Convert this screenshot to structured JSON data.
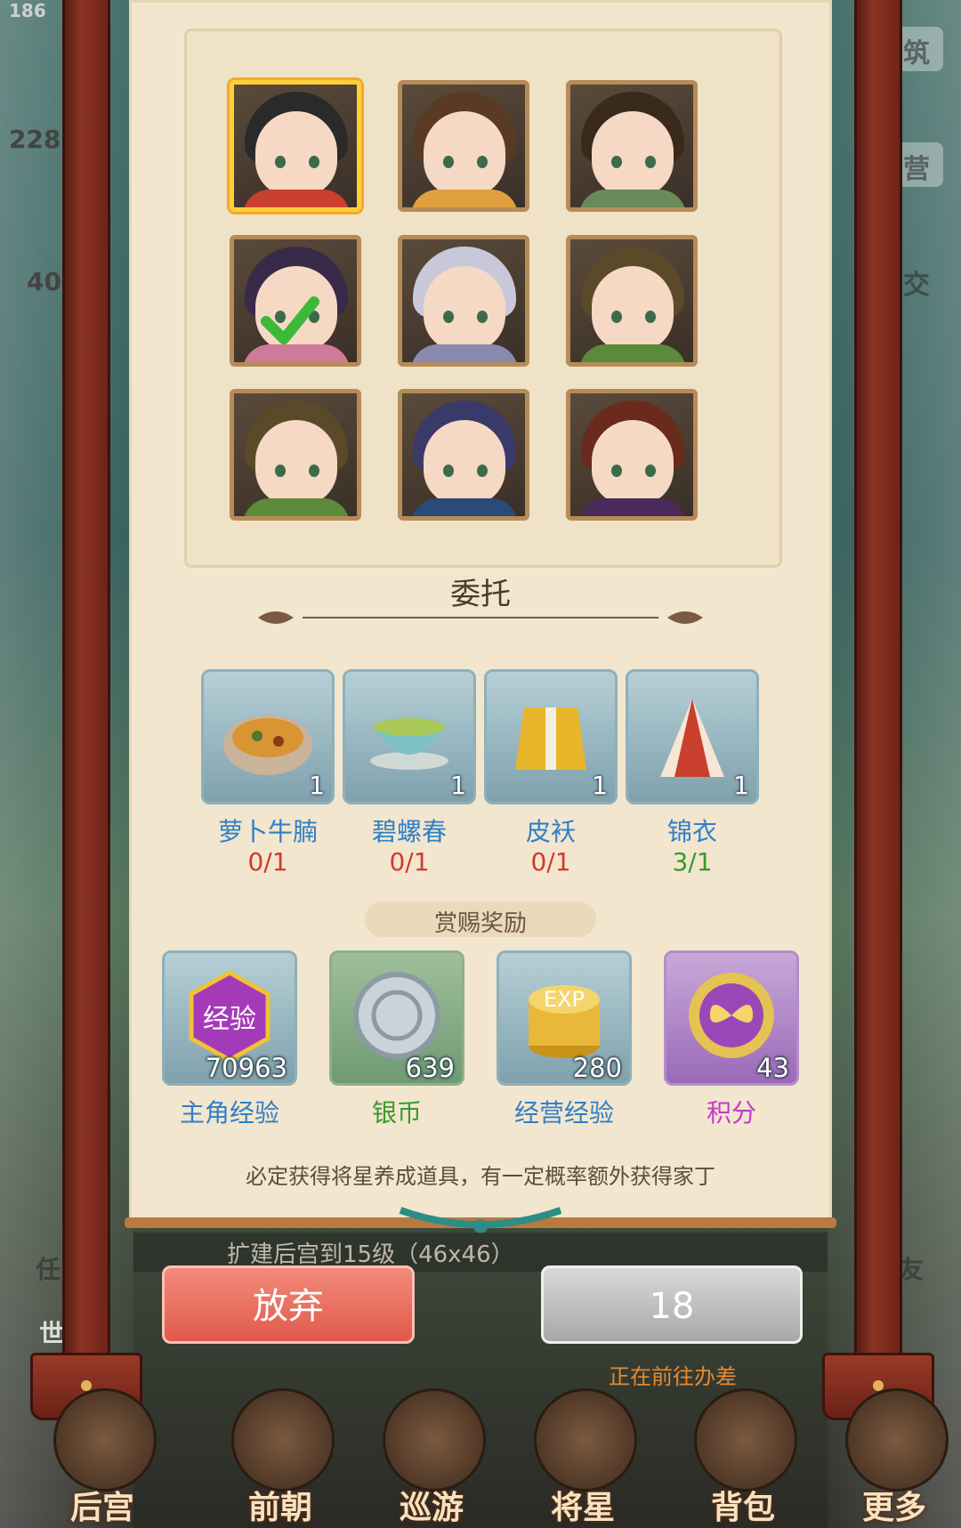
{
  "background": {
    "top_left_number": "186",
    "left_numbers": [
      "228",
      "40"
    ],
    "right_labels": [
      "筑",
      "营",
      "交"
    ],
    "left_labels": [
      "任",
      "世"
    ],
    "right_labels_bottom": [
      "友"
    ]
  },
  "heroes": [
    {
      "name": "hero-1",
      "selected": true
    },
    {
      "name": "hero-2",
      "selected": false
    },
    {
      "name": "hero-3",
      "selected": false
    },
    {
      "name": "hero-4",
      "selected": false,
      "checked": true
    },
    {
      "name": "hero-5",
      "selected": false
    },
    {
      "name": "hero-6",
      "selected": false
    },
    {
      "name": "hero-7",
      "selected": false
    },
    {
      "name": "hero-8",
      "selected": false
    },
    {
      "name": "hero-9",
      "selected": false
    }
  ],
  "task": {
    "title": "委托",
    "items": [
      {
        "name": "萝卜牛腩",
        "count": "1",
        "progress": "0/1",
        "status_color": "#d23a2a",
        "icon": "stew-pot-icon"
      },
      {
        "name": "碧螺春",
        "count": "1",
        "progress": "0/1",
        "status_color": "#d23a2a",
        "icon": "tea-bowl-icon"
      },
      {
        "name": "皮袄",
        "count": "1",
        "progress": "0/1",
        "status_color": "#d23a2a",
        "icon": "fur-jacket-icon"
      },
      {
        "name": "锦衣",
        "count": "1",
        "progress": "3/1",
        "status_color": "#3a9a2a",
        "icon": "brocade-robe-icon"
      }
    ]
  },
  "rewards": {
    "title": "赏赐奖励",
    "items": [
      {
        "name": "主角经验",
        "amount": "70963",
        "badge_text": "经验",
        "color": "#2f7fc8",
        "icon": "experience-gem-icon"
      },
      {
        "name": "银币",
        "amount": "639",
        "color": "#3a9a2a",
        "icon": "silver-coin-icon"
      },
      {
        "name": "经营经验",
        "amount": "280",
        "badge_text": "EXP",
        "color": "#2f7fc8",
        "icon": "exp-coins-icon"
      },
      {
        "name": "积分",
        "amount": "43",
        "color": "#c23ac8",
        "icon": "butterfly-medal-icon"
      }
    ],
    "notice": "必定获得将星养成道具，有一定概率额外获得家丁"
  },
  "banner_text": "扩建后宫到15级（46x46）",
  "buttons": {
    "abandon": "放弃",
    "timer": "18"
  },
  "status_text": "正在前往办差",
  "nav": [
    "后宫",
    "前朝",
    "巡游",
    "将星",
    "背包",
    "更多"
  ]
}
